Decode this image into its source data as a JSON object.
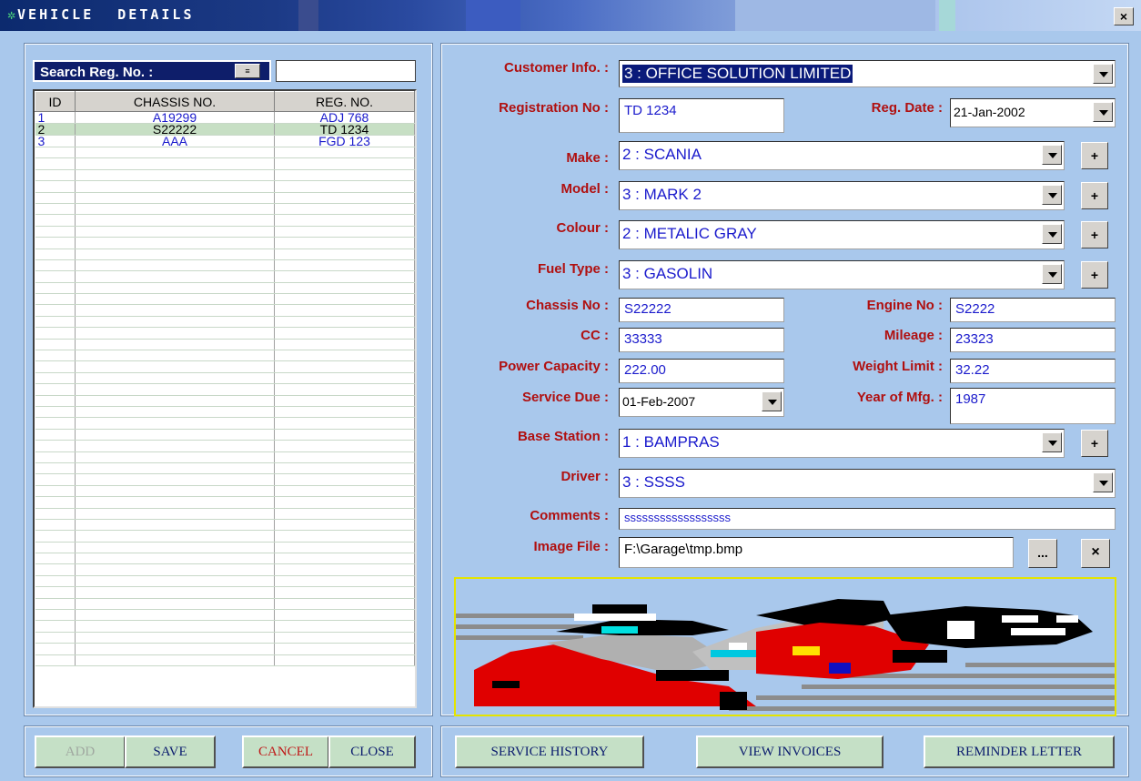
{
  "window": {
    "title": "VEHICLE DETAILS",
    "close_glyph": "×"
  },
  "search": {
    "label": "Search Reg. No. :",
    "value": ""
  },
  "grid": {
    "headers": [
      "ID",
      "CHASSIS NO.",
      "REG. NO."
    ],
    "rows": [
      {
        "id": "1",
        "chassis": "A19299",
        "reg": "ADJ 768"
      },
      {
        "id": "2",
        "chassis": "S22222",
        "reg": "TD 1234"
      },
      {
        "id": "3",
        "chassis": "AAA",
        "reg": "FGD 123"
      }
    ],
    "selected_row": 1
  },
  "form": {
    "customer_label": "Customer Info. :",
    "customer_value": "3 : OFFICE SOLUTION LIMITED",
    "reg_no_label": "Registration No :",
    "reg_no_value": "TD 1234",
    "reg_date_label": "Reg. Date :",
    "reg_date_value": "21-Jan-2002",
    "make_label": "Make :",
    "make_value": "2 : SCANIA",
    "model_label": "Model :",
    "model_value": "3 : MARK 2",
    "colour_label": "Colour :",
    "colour_value": "2 : METALIC GRAY",
    "fuel_label": "Fuel Type :",
    "fuel_value": "3 : GASOLIN",
    "chassis_label": "Chassis No :",
    "chassis_value": "S22222",
    "engine_label": "Engine No :",
    "engine_value": "S2222",
    "cc_label": "CC :",
    "cc_value": "33333",
    "mileage_label": "Mileage :",
    "mileage_value": "23323",
    "power_label": "Power Capacity :",
    "power_value": "222.00",
    "weight_label": "Weight Limit :",
    "weight_value": "32.22",
    "service_label": "Service Due :",
    "service_value": "01-Feb-2007",
    "year_label": "Year of Mfg. :",
    "year_value": "1987",
    "base_label": "Base Station :",
    "base_value": "1 : BAMPRAS",
    "driver_label": "Driver :",
    "driver_value": "3 : SSSS",
    "comments_label": "Comments :",
    "comments_value": "ssssssssssssssssss",
    "image_label": "Image File :",
    "image_value": "F:\\Garage\\tmp.bmp",
    "browse_label": "...",
    "clear_label": "×",
    "plus_label": "+"
  },
  "buttons": {
    "add": "ADD",
    "save": "SAVE",
    "cancel": "CANCEL",
    "close": "CLOSE",
    "service_history": "SERVICE HISTORY",
    "view_invoices": "VIEW INVOICES",
    "reminder": "REMINDER LETTER"
  },
  "colors": {
    "label": "#b01010",
    "value": "#1a1acc",
    "button_bg": "#c5e0c6",
    "background": "#a9c8ec"
  }
}
